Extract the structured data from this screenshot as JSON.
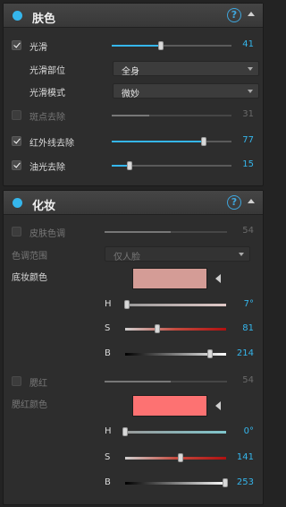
{
  "skin": {
    "title": "肤色",
    "help": "?",
    "smooth": {
      "label": "光滑",
      "checked": true,
      "value": "41",
      "fraction": 0.41
    },
    "smooth_area": {
      "label": "光滑部位",
      "selected": "全身"
    },
    "smooth_mode": {
      "label": "光滑模式",
      "selected": "微妙"
    },
    "spot_removal": {
      "label": "斑点去除",
      "checked": false,
      "value": "31",
      "fraction": 0.31
    },
    "infrared": {
      "label": "红外线去除",
      "checked": true,
      "value": "77",
      "fraction": 0.77
    },
    "shine": {
      "label": "油光去除",
      "checked": true,
      "value": "15",
      "fraction": 0.15
    }
  },
  "makeup": {
    "title": "化妆",
    "help": "?",
    "skin_tone": {
      "label": "皮肤色调",
      "checked": false,
      "value": "54",
      "fraction": 0.54
    },
    "tone_range": {
      "label": "色调范围",
      "selected": "仅人脸"
    },
    "foundation_color": {
      "label": "底妆颜色",
      "color": "#d49c96",
      "h": {
        "label": "H",
        "value": "7°",
        "fraction": 0.02
      },
      "s": {
        "label": "S",
        "value": "81",
        "fraction": 0.32
      },
      "b": {
        "label": "B",
        "value": "214",
        "fraction": 0.84
      }
    },
    "blush": {
      "label": "腮红",
      "checked": false,
      "value": "54",
      "fraction": 0.54
    },
    "blush_color": {
      "label": "腮红颜色",
      "color": "#fd7272",
      "h": {
        "label": "H",
        "value": "0°",
        "fraction": 0.0
      },
      "s": {
        "label": "S",
        "value": "141",
        "fraction": 0.55
      },
      "b": {
        "label": "B",
        "value": "253",
        "fraction": 0.99
      }
    }
  },
  "colors": {
    "accent": "#35b6ec",
    "panel": "#2d2d2d",
    "header": "#3e3e3e"
  }
}
